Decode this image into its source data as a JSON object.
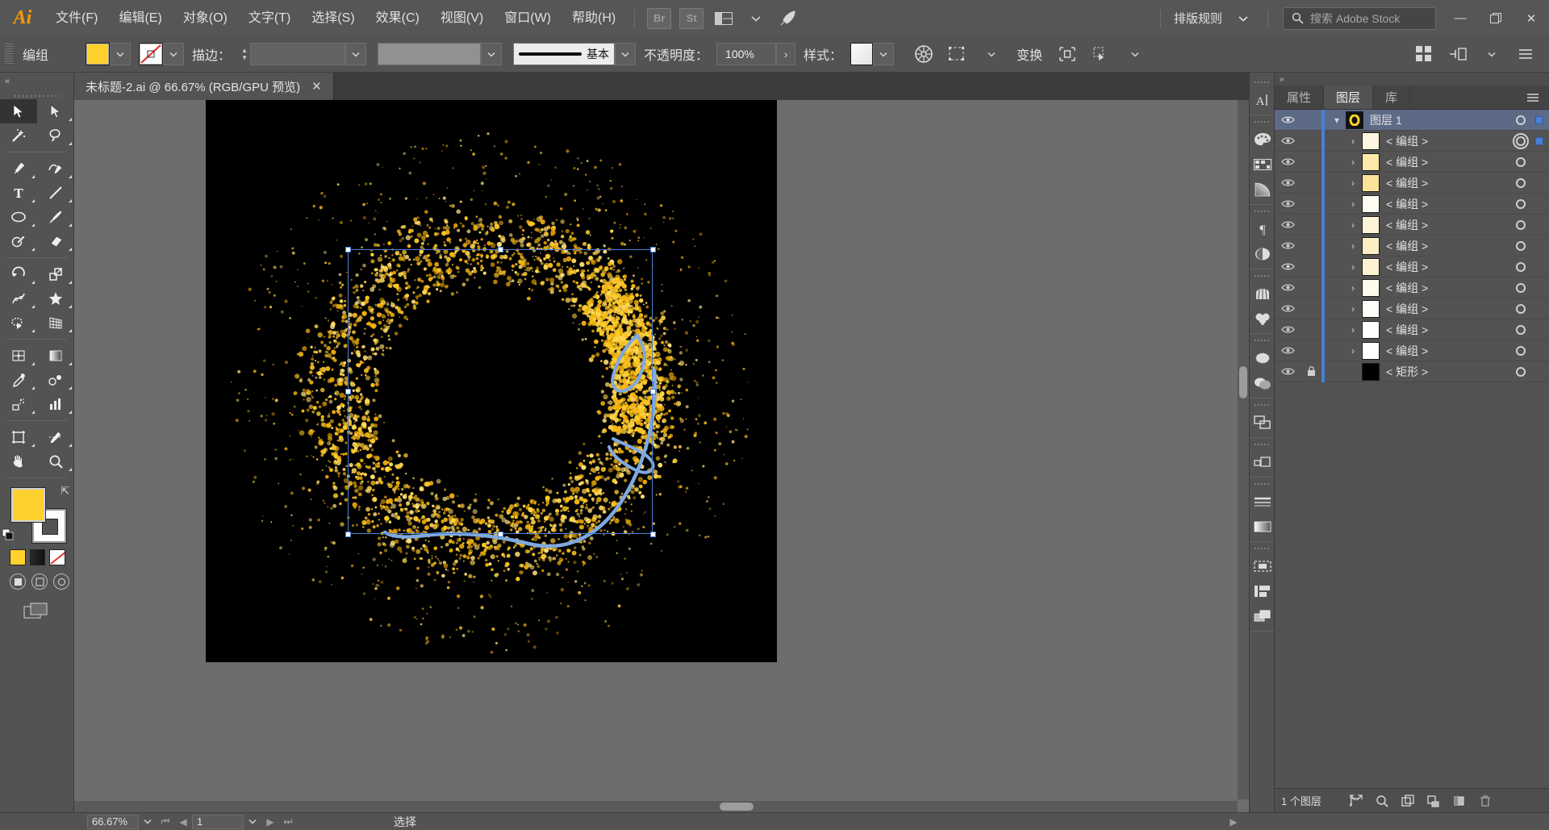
{
  "app": {
    "name": "Adobe Illustrator",
    "logo": "Ai"
  },
  "menubar": {
    "items": [
      {
        "label": "文件(F)",
        "name": "menu-file"
      },
      {
        "label": "编辑(E)",
        "name": "menu-edit"
      },
      {
        "label": "对象(O)",
        "name": "menu-object"
      },
      {
        "label": "文字(T)",
        "name": "menu-type"
      },
      {
        "label": "选择(S)",
        "name": "menu-select"
      },
      {
        "label": "效果(C)",
        "name": "menu-effect"
      },
      {
        "label": "视图(V)",
        "name": "menu-view"
      },
      {
        "label": "窗口(W)",
        "name": "menu-window"
      },
      {
        "label": "帮助(H)",
        "name": "menu-help"
      }
    ],
    "bridge_label": "Br",
    "stock_label": "St",
    "arrange_label": "排版规则",
    "search_placeholder": "搜索 Adobe Stock",
    "minimize": "—",
    "maximize": "❐",
    "close": "✕"
  },
  "controlbar": {
    "object_label": "编组",
    "fill_color": "#FFD12E",
    "stroke_label": "描边：",
    "stroke_weight": "",
    "brush_label": "基本",
    "opacity_label": "不透明度：",
    "opacity_value": "100%",
    "style_label": "样式：",
    "transform_label": "变换"
  },
  "toolbar": {
    "tools": [
      {
        "name": "selection-tool",
        "label": "选择工具"
      },
      {
        "name": "direct-selection-tool",
        "label": "直接选择工具"
      },
      {
        "name": "magic-wand-tool",
        "label": "魔棒工具"
      },
      {
        "name": "lasso-tool",
        "label": "套索工具"
      },
      {
        "name": "pen-tool",
        "label": "钢笔工具"
      },
      {
        "name": "curvature-tool",
        "label": "曲率工具"
      },
      {
        "name": "type-tool",
        "label": "文字工具"
      },
      {
        "name": "line-segment-tool",
        "label": "直线段工具"
      },
      {
        "name": "ellipse-tool",
        "label": "椭圆工具"
      },
      {
        "name": "paintbrush-tool",
        "label": "画笔工具"
      },
      {
        "name": "shaper-tool",
        "label": "Shaper 工具"
      },
      {
        "name": "eraser-tool",
        "label": "橡皮擦工具"
      },
      {
        "name": "rotate-tool",
        "label": "旋转工具"
      },
      {
        "name": "scale-tool",
        "label": "比例缩放工具"
      },
      {
        "name": "width-tool",
        "label": "宽度工具"
      },
      {
        "name": "free-transform-tool",
        "label": "自由变换工具"
      },
      {
        "name": "shape-builder-tool",
        "label": "形状生成器工具"
      },
      {
        "name": "perspective-grid-tool",
        "label": "透视网格工具"
      },
      {
        "name": "mesh-tool",
        "label": "网格工具"
      },
      {
        "name": "gradient-tool",
        "label": "渐变工具"
      },
      {
        "name": "eyedropper-tool",
        "label": "吸管工具"
      },
      {
        "name": "blend-tool",
        "label": "混合工具"
      },
      {
        "name": "symbol-sprayer-tool",
        "label": "符号喷枪工具"
      },
      {
        "name": "column-graph-tool",
        "label": "柱形图工具"
      },
      {
        "name": "artboard-tool",
        "label": "画板工具"
      },
      {
        "name": "slice-tool",
        "label": "切片工具"
      },
      {
        "name": "hand-tool",
        "label": "抓手工具"
      },
      {
        "name": "zoom-tool",
        "label": "缩放工具"
      }
    ],
    "fill_color": "#FFD12E",
    "stroke_color": "#FFFFFF"
  },
  "document": {
    "tab_title": "未标题-2.ai @ 66.67% (RGB/GPU 预览)",
    "close_glyph": "✕",
    "artboard_background": "#000000",
    "particle_color": "#FFC925",
    "path_color": "#7FA9E0",
    "selection_color": "#4a7fd4"
  },
  "rail": {
    "icons": [
      {
        "name": "character-panel-icon"
      },
      {
        "name": "color-panel-icon"
      },
      {
        "name": "swatches-panel-icon"
      },
      {
        "name": "gradient-panel-icon"
      },
      {
        "name": "paragraph-panel-icon"
      },
      {
        "name": "transparency-panel-icon"
      },
      {
        "name": "brushes-panel-icon"
      },
      {
        "name": "symbols-panel-icon"
      },
      {
        "name": "appearance-panel-icon"
      },
      {
        "name": "graphic-styles-panel-icon"
      },
      {
        "name": "pathfinder-panel-icon"
      },
      {
        "name": "align-panel-icon"
      },
      {
        "name": "stroke-panel-icon"
      },
      {
        "name": "gradient-bar-icon"
      },
      {
        "name": "artboards-panel-icon"
      },
      {
        "name": "asset-export-icon"
      },
      {
        "name": "links-panel-icon"
      }
    ]
  },
  "panel": {
    "tabs": [
      {
        "label": "属性",
        "name": "tab-properties",
        "active": false
      },
      {
        "label": "图层",
        "name": "tab-layers",
        "active": true
      },
      {
        "label": "库",
        "name": "tab-libraries",
        "active": false
      }
    ],
    "root_layer": {
      "name": "图层 1",
      "thumb_color": "#FFD12E",
      "visible": true,
      "expanded": true
    },
    "rows": [
      {
        "name": "< 编组 >",
        "thumb": "#fdf6e0",
        "locked": false,
        "targeted": true,
        "selected": true
      },
      {
        "name": "< 编组 >",
        "thumb": "#fce9a8",
        "locked": false,
        "targeted": false,
        "selected": false
      },
      {
        "name": "< 编组 >",
        "thumb": "#fbe39a",
        "locked": false,
        "targeted": false,
        "selected": false
      },
      {
        "name": "< 编组 >",
        "thumb": "#fdfbf2",
        "locked": false,
        "targeted": false,
        "selected": false
      },
      {
        "name": "< 编组 >",
        "thumb": "#fdf4d8",
        "locked": false,
        "targeted": false,
        "selected": false
      },
      {
        "name": "< 编组 >",
        "thumb": "#fcefc6",
        "locked": false,
        "targeted": false,
        "selected": false
      },
      {
        "name": "< 编组 >",
        "thumb": "#fdf3d2",
        "locked": false,
        "targeted": false,
        "selected": false
      },
      {
        "name": "< 编组 >",
        "thumb": "#fdfaee",
        "locked": false,
        "targeted": false,
        "selected": false
      },
      {
        "name": "< 编组 >",
        "thumb": "#fefdf8",
        "locked": false,
        "targeted": false,
        "selected": false
      },
      {
        "name": "< 编组 >",
        "thumb": "#ffffff",
        "locked": false,
        "targeted": false,
        "selected": false
      },
      {
        "name": "< 编组 >",
        "thumb": "#ffffff",
        "locked": false,
        "targeted": false,
        "selected": false
      },
      {
        "name": "< 矩形 >",
        "thumb": "#000000",
        "locked": true,
        "targeted": false,
        "selected": false
      }
    ],
    "footer": {
      "count_label": "1 个图层",
      "icons": [
        {
          "name": "locate-object-icon"
        },
        {
          "name": "make-clipping-mask-icon"
        },
        {
          "name": "create-new-sublayer-icon"
        },
        {
          "name": "create-new-layer-icon"
        },
        {
          "name": "delete-selection-icon"
        }
      ]
    }
  },
  "statusbar": {
    "zoom_value": "66.67%",
    "page_value": "1",
    "status_text": "选择"
  }
}
